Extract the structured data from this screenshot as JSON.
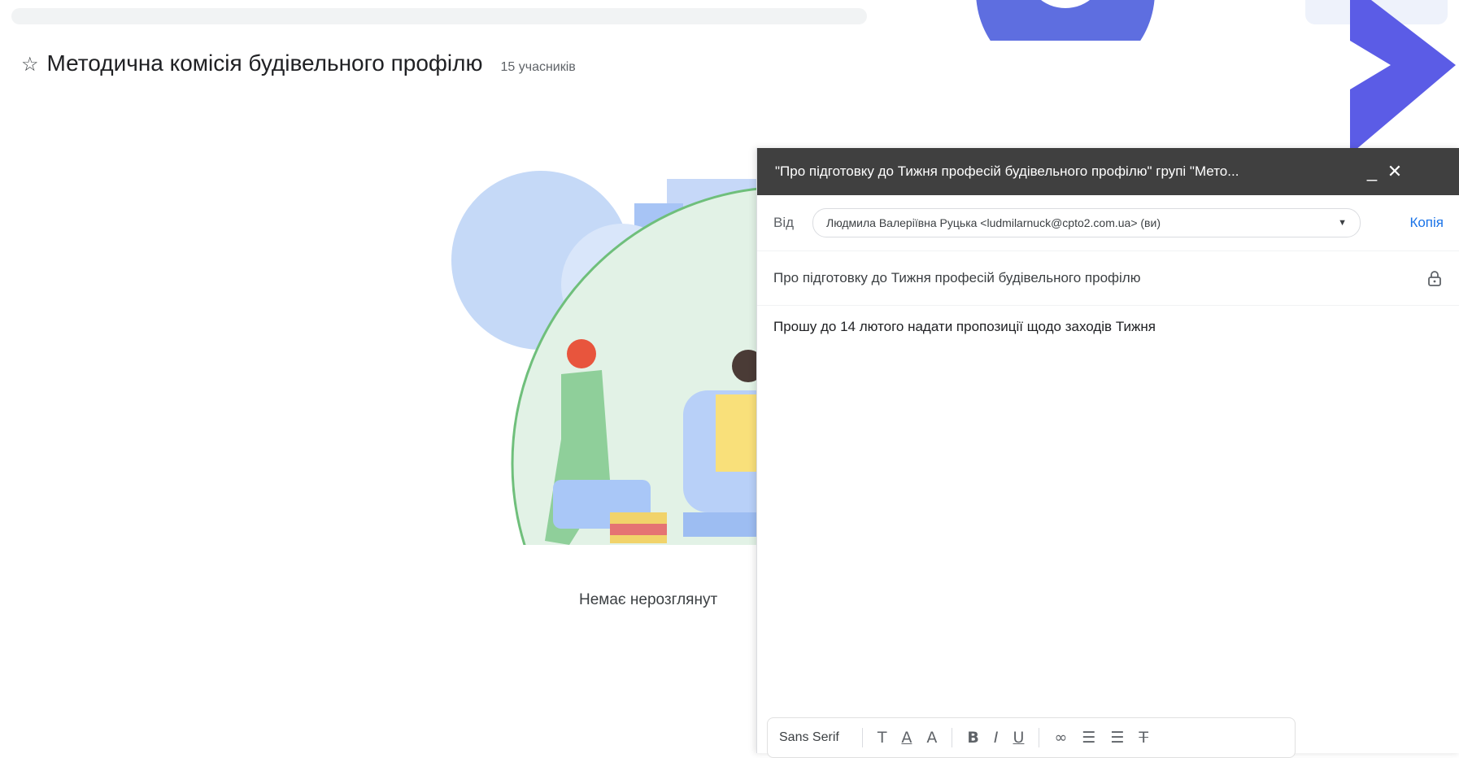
{
  "group": {
    "star_icon": "star-outline-icon",
    "star_glyph": "☆",
    "title": "Методична комісія будівельного профілю",
    "members": "15 учасників"
  },
  "empty_state": {
    "text": "Немає нерозглянут"
  },
  "compose": {
    "title": "\"Про підготовку до Тижня професій будівельного профілю\" групі \"Мето...",
    "minimize_glyph": "_",
    "close_glyph": "✕",
    "from_label": "Від",
    "from_value": "Людмила Валеріївна Руцька <ludmilarnuck@cpto2.com.ua> (ви)",
    "caret_glyph": "▼",
    "copy_label": "Копія",
    "subject": "Про підготовку до Тижня професій будівельного профілю",
    "body": "Прошу до 14 лютого надати пропозиції щодо заходів Тижня"
  },
  "toolbar": {
    "font": "Sans Serif",
    "buttons": [
      {
        "name": "font-size-icon",
        "glyph": "T"
      },
      {
        "name": "text-color-icon",
        "glyph": "A"
      },
      {
        "name": "highlight-icon",
        "glyph": "A"
      },
      {
        "name": "bold-icon",
        "glyph": "B"
      },
      {
        "name": "italic-icon",
        "glyph": "I"
      },
      {
        "name": "underline-icon",
        "glyph": "U"
      },
      {
        "name": "link-icon",
        "glyph": "∞"
      },
      {
        "name": "numbered-list-icon",
        "glyph": "☰"
      },
      {
        "name": "bulleted-list-icon",
        "glyph": "☰"
      },
      {
        "name": "clear-format-icon",
        "glyph": "T"
      }
    ]
  },
  "colors": {
    "compose_header": "#404040",
    "accent_blue": "#1a73e8",
    "deco_purple": "#5b5ce6"
  }
}
